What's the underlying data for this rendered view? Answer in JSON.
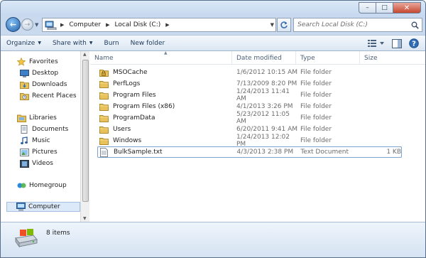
{
  "window": {
    "minimize_glyph": "–",
    "maximize_glyph": "□",
    "close_glyph": "✕"
  },
  "nav": {
    "back_glyph": "←",
    "forward_glyph": "→"
  },
  "address": {
    "segments": [
      "Computer",
      "Local Disk (C:)"
    ]
  },
  "search": {
    "placeholder": "Search Local Disk (C:)"
  },
  "toolbar": {
    "organize": "Organize",
    "share_with": "Share with",
    "burn": "Burn",
    "new_folder": "New folder"
  },
  "sidebar": {
    "favorites": {
      "label": "Favorites",
      "items": [
        "Desktop",
        "Downloads",
        "Recent Places"
      ]
    },
    "libraries": {
      "label": "Libraries",
      "items": [
        "Documents",
        "Music",
        "Pictures",
        "Videos"
      ]
    },
    "homegroup": "Homegroup",
    "computer": "Computer"
  },
  "columns": {
    "name": "Name",
    "date": "Date modified",
    "type": "Type",
    "size": "Size"
  },
  "files": [
    {
      "name": "MSOCache",
      "date": "1/6/2012 10:15 AM",
      "type": "File folder",
      "size": "",
      "icon": "locked-folder-icon"
    },
    {
      "name": "PerfLogs",
      "date": "7/13/2009 8:20 PM",
      "type": "File folder",
      "size": "",
      "icon": "folder-icon"
    },
    {
      "name": "Program Files",
      "date": "1/24/2013 11:41 AM",
      "type": "File folder",
      "size": "",
      "icon": "folder-icon"
    },
    {
      "name": "Program Files (x86)",
      "date": "4/1/2013 3:26 PM",
      "type": "File folder",
      "size": "",
      "icon": "folder-icon"
    },
    {
      "name": "ProgramData",
      "date": "5/23/2012 11:05 AM",
      "type": "File folder",
      "size": "",
      "icon": "folder-icon"
    },
    {
      "name": "Users",
      "date": "6/20/2011 9:41 AM",
      "type": "File folder",
      "size": "",
      "icon": "folder-icon"
    },
    {
      "name": "Windows",
      "date": "1/24/2013 12:02 PM",
      "type": "File folder",
      "size": "",
      "icon": "folder-icon"
    },
    {
      "name": "BulkSample.txt",
      "date": "4/3/2013 2:38 PM",
      "type": "Text Document",
      "size": "1 KB",
      "icon": "text-file-icon"
    }
  ],
  "status": {
    "count": "8 items"
  },
  "colors": {
    "folder": "#e8c25a",
    "accent": "#3a6fb0"
  }
}
